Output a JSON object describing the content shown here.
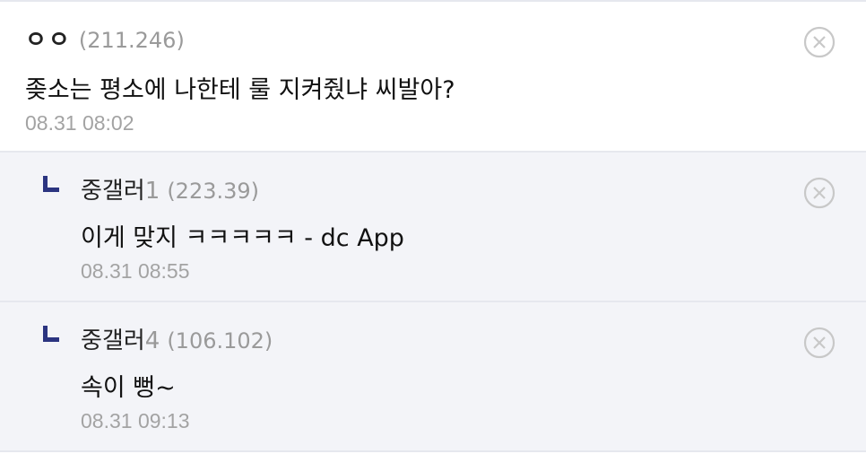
{
  "comments": [
    {
      "nick": "ㅇㅇ",
      "nick_num": "",
      "ip": "(211.246)",
      "text": "좆소는 평소에 나한테 룰 지켜줬냐 씨발아?",
      "date": "08.31 08:02",
      "icon": "circle-x-icon"
    },
    {
      "nick": "중갤러",
      "nick_num": "1",
      "ip": "(223.39)",
      "text": "이게 맞지 ㅋㅋㅋㅋㅋ - dc App",
      "date": "08.31 08:55",
      "icon": "circle-x-icon"
    },
    {
      "nick": "중갤러",
      "nick_num": "4",
      "ip": "(106.102)",
      "text": "속이 뻥~",
      "date": "08.31 09:13",
      "icon": "circle-x-icon"
    }
  ],
  "colors": {
    "reply_marker": "#2b3480",
    "reply_bg": "#f3f4f8",
    "meta_gray": "#9a9a9a",
    "divider": "#e6e8ee"
  }
}
